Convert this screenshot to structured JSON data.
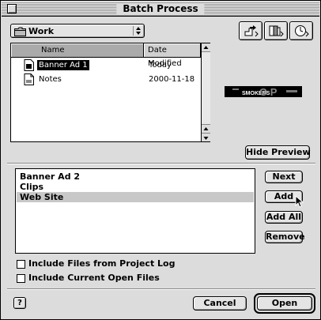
{
  "window": {
    "title": "Batch Process"
  },
  "folder_popup": {
    "label": "Work",
    "icon": "folder-icon"
  },
  "toolbar_icons": [
    "shortcuts-icon",
    "favorites-icon",
    "recent-icon"
  ],
  "browser": {
    "columns": [
      "Name",
      "Date Modified"
    ],
    "rows": [
      {
        "name": "Banner Ad 1",
        "date": "Today",
        "selected": true
      },
      {
        "name": "Notes",
        "date": "2000-11-18",
        "selected": false
      }
    ]
  },
  "preview": {
    "image_text": "SMOKERS"
  },
  "hide_preview_label": "Hide Preview",
  "selected_list": {
    "items": [
      {
        "label": "Banner Ad 2",
        "selected": false
      },
      {
        "label": "Clips",
        "selected": false
      },
      {
        "label": "Web Site",
        "selected": true
      }
    ]
  },
  "side_buttons": {
    "next": "Next",
    "add": "Add",
    "add_all": "Add All",
    "remove": "Remove"
  },
  "options": [
    {
      "label": "Include Files from Project Log",
      "checked": false
    },
    {
      "label": "Include Current Open Files",
      "checked": false
    }
  ],
  "footer": {
    "help": "?",
    "cancel": "Cancel",
    "open": "Open"
  }
}
